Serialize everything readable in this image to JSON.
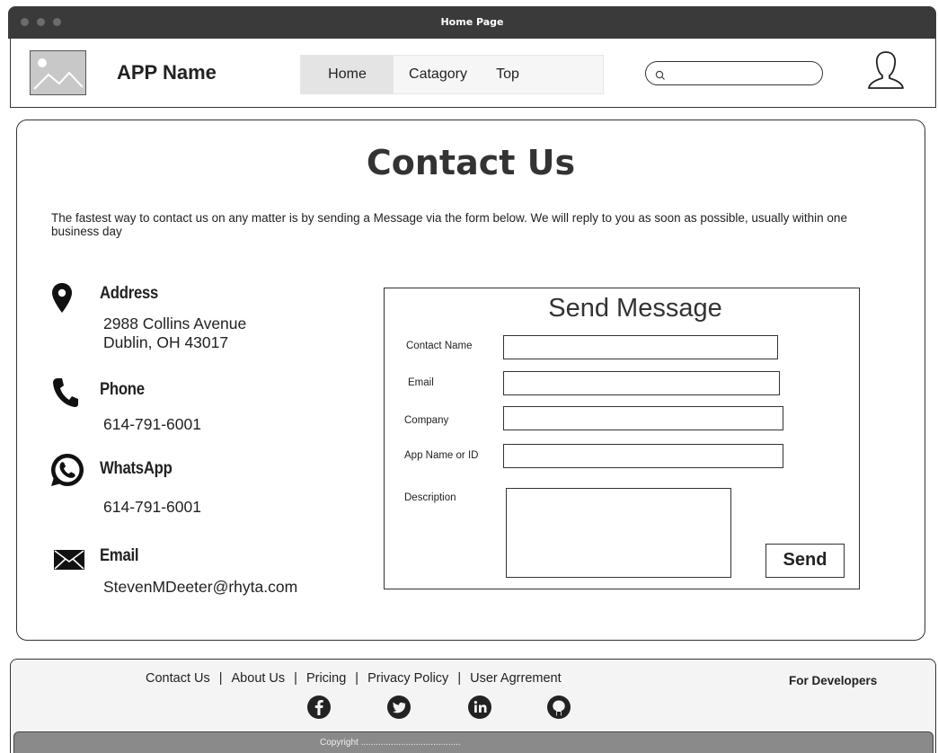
{
  "window": {
    "title": "Home Page"
  },
  "header": {
    "app_name": "APP Name",
    "nav": [
      {
        "label": "Home",
        "active": true
      },
      {
        "label": "Catagory",
        "active": false
      },
      {
        "label": "Top",
        "active": false
      }
    ],
    "search": {
      "placeholder": "",
      "value": ""
    }
  },
  "main": {
    "title": "Contact Us",
    "intro": "The fastest way to contact us on any matter is by sending a Message via the form below. We will reply to you as soon as possible, usually within one business day",
    "contacts": [
      {
        "icon": "map-pin-icon",
        "heading": "Address",
        "value_line1": "2988 Collins Avenue",
        "value_line2": "Dublin, OH 43017"
      },
      {
        "icon": "phone-icon",
        "heading": "Phone",
        "value": "614-791-6001"
      },
      {
        "icon": "whatsapp-icon",
        "heading": "WhatsApp",
        "value": "614-791-6001"
      },
      {
        "icon": "envelope-icon",
        "heading": "Email",
        "value": "StevenMDeeter@rhyta.com"
      }
    ],
    "form": {
      "title": "Send Message",
      "fields": [
        {
          "label": "Contact Name",
          "value": ""
        },
        {
          "label": "Email",
          "value": ""
        },
        {
          "label": "Company",
          "value": ""
        },
        {
          "label": "App Name or ID",
          "value": ""
        },
        {
          "label": "Description",
          "value": ""
        }
      ],
      "send_label": "Send"
    }
  },
  "footer": {
    "links": [
      "Contact Us",
      "About Us",
      "Pricing",
      "Privacy Policy",
      "User Agrrement"
    ],
    "for_developers": "For Developers",
    "socials": [
      "facebook-icon",
      "twitter-icon",
      "linkedin-icon",
      "github-icon"
    ],
    "copyright": "Copyright ........................................"
  },
  "colors": {
    "title_bar": "#3a3a3a",
    "copyright_bar": "#8a8a8a",
    "nav_active": "#e4e4e4"
  }
}
